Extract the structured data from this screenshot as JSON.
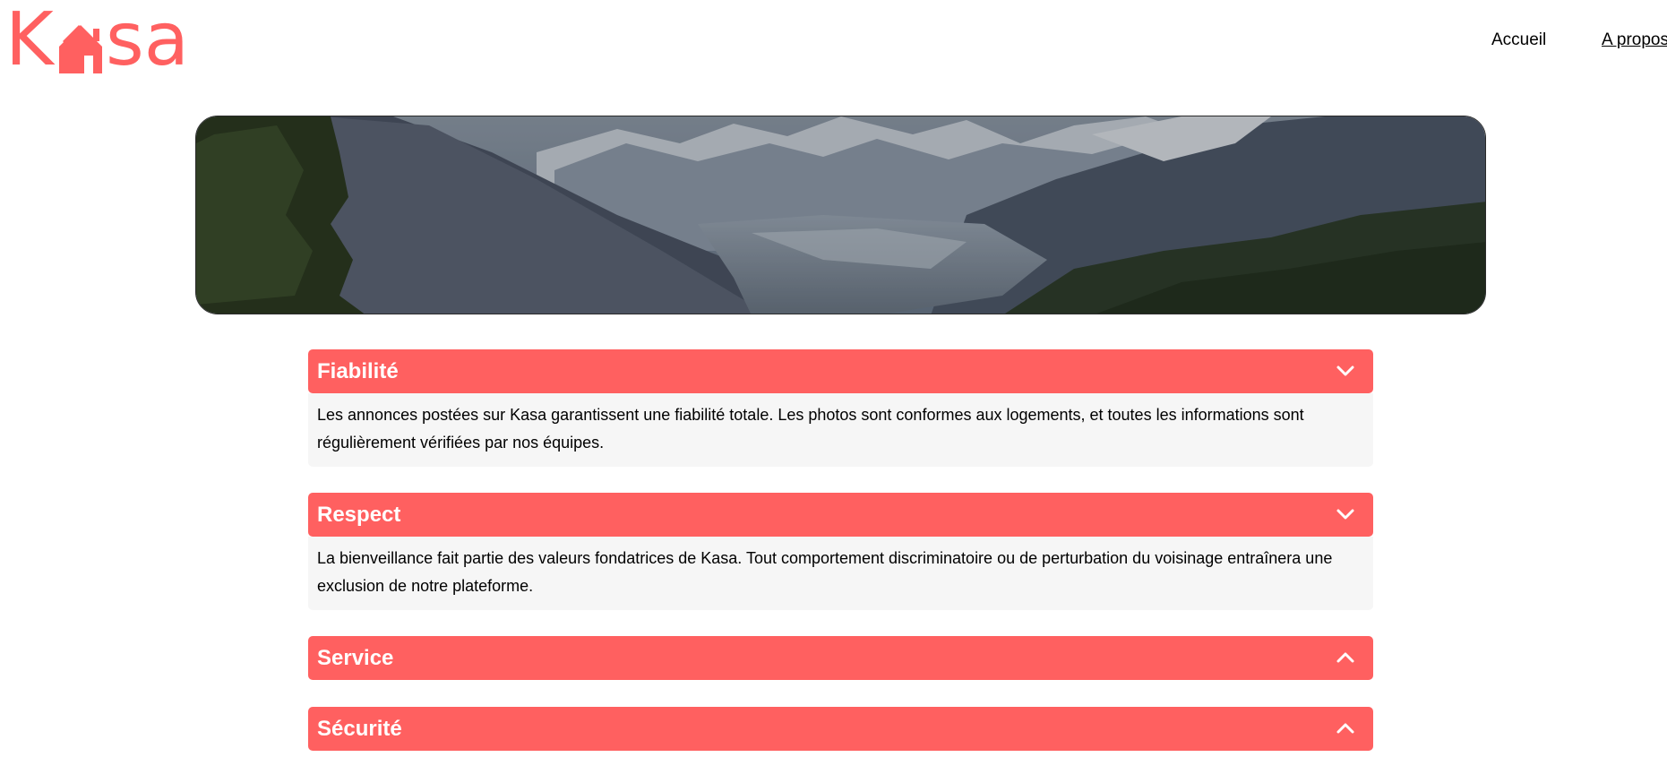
{
  "brand": {
    "logo_text": "Kasa",
    "accent_color": "#FF6060"
  },
  "nav": {
    "home_label": "Accueil",
    "about_label": "A propos"
  },
  "banner": {
    "image": "mountain-valley-landscape"
  },
  "collapses": [
    {
      "title": "Fiabilité",
      "expanded": true,
      "chevron": "chevron-down-icon",
      "content": "Les annonces postées sur Kasa garantissent une fiabilité totale. Les photos sont conformes aux logements, et toutes les informations sont régulièrement vérifiées par nos équipes."
    },
    {
      "title": "Respect",
      "expanded": true,
      "chevron": "chevron-down-icon",
      "content": "La bienveillance fait partie des valeurs fondatrices de Kasa. Tout comportement discriminatoire ou de perturbation du voisinage entraînera une exclusion de notre plateforme."
    },
    {
      "title": "Service",
      "expanded": false,
      "chevron": "chevron-up-icon"
    },
    {
      "title": "Sécurité",
      "expanded": false,
      "chevron": "chevron-up-icon"
    }
  ],
  "colors": {
    "collapse_header": "#FF6060",
    "collapse_body": "#F6F6F6",
    "text": "#000000"
  }
}
